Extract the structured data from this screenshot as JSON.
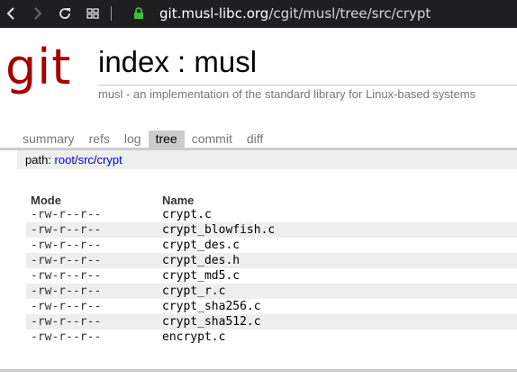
{
  "browser": {
    "url_domain": "git.musl-libc.org",
    "url_path": "/cgit/musl/tree/src/crypt"
  },
  "header": {
    "logo_text": "git",
    "title": "index : musl",
    "subtitle": "musl - an implementation of the standard library for Linux-based systems"
  },
  "tabs": [
    {
      "label": "summary"
    },
    {
      "label": "refs"
    },
    {
      "label": "log"
    },
    {
      "label": "tree"
    },
    {
      "label": "commit"
    },
    {
      "label": "diff"
    }
  ],
  "active_tab": "tree",
  "path": {
    "label": "path: ",
    "root": "root",
    "src": "src",
    "crypt": "crypt"
  },
  "table": {
    "mode_header": "Mode",
    "name_header": "Name",
    "rows": [
      {
        "mode": "-rw-r--r--",
        "name": "crypt.c"
      },
      {
        "mode": "-rw-r--r--",
        "name": "crypt_blowfish.c"
      },
      {
        "mode": "-rw-r--r--",
        "name": "crypt_des.c"
      },
      {
        "mode": "-rw-r--r--",
        "name": "crypt_des.h"
      },
      {
        "mode": "-rw-r--r--",
        "name": "crypt_md5.c"
      },
      {
        "mode": "-rw-r--r--",
        "name": "crypt_r.c"
      },
      {
        "mode": "-rw-r--r--",
        "name": "crypt_sha256.c"
      },
      {
        "mode": "-rw-r--r--",
        "name": "crypt_sha512.c"
      },
      {
        "mode": "-rw-r--r--",
        "name": "encrypt.c"
      }
    ]
  },
  "colors": {
    "logo": "#a30000",
    "link": "#0000ee",
    "tab_active_bg": "#cccccc",
    "lock_icon": "#3fbf3f"
  }
}
